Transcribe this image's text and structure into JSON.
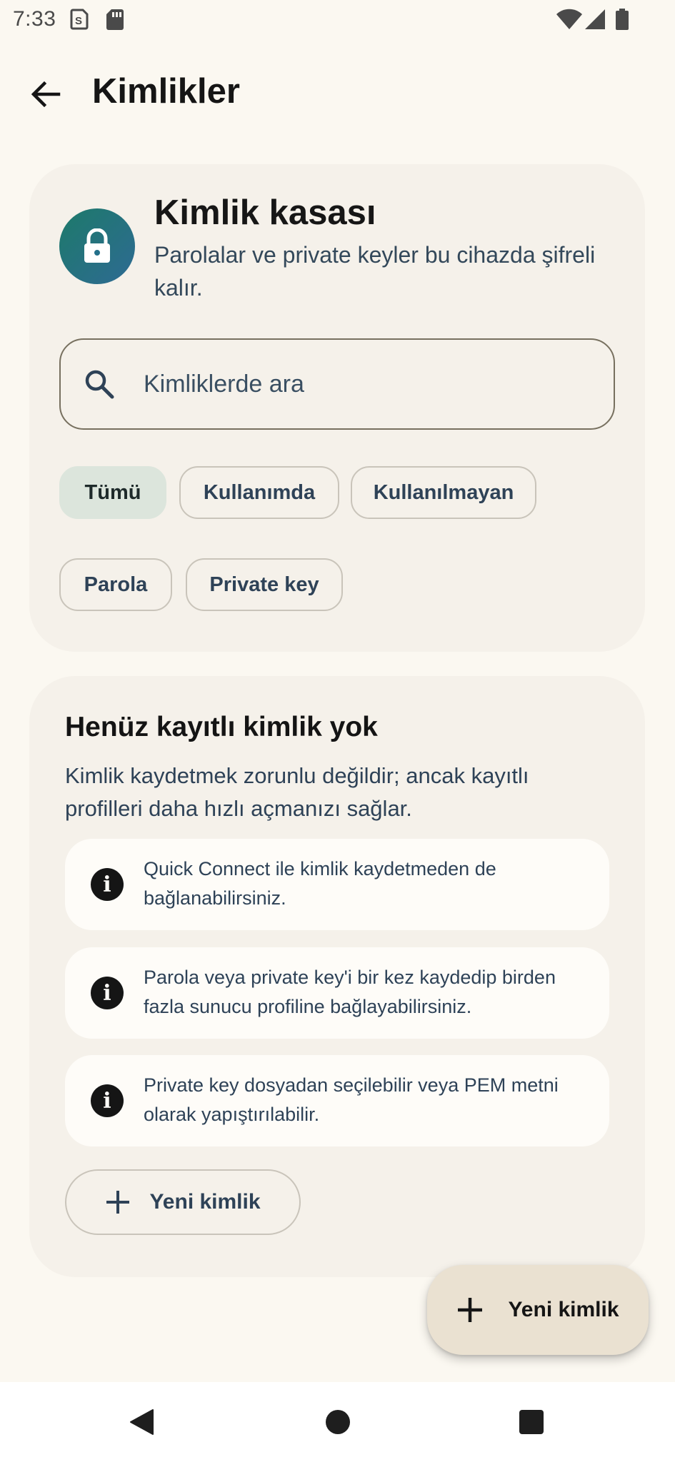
{
  "status_bar": {
    "time": "7:33",
    "icons": [
      "sim-icon",
      "sd-card-icon",
      "wifi-icon",
      "signal-icon",
      "battery-icon"
    ]
  },
  "app_bar": {
    "back_icon": "arrow-back-icon",
    "title": "Kimlikler"
  },
  "vault": {
    "icon": "lock-icon",
    "title": "Kimlik kasası",
    "subtitle": "Parolalar ve private keyler bu cihazda şifreli kalır.",
    "search": {
      "icon": "search-icon",
      "placeholder": "Kimliklerde ara",
      "value": ""
    },
    "filters": [
      {
        "label": "Tümü",
        "selected": true
      },
      {
        "label": "Kullanımda",
        "selected": false
      },
      {
        "label": "Kullanılmayan",
        "selected": false
      },
      {
        "label": "Parola",
        "selected": false
      },
      {
        "label": "Private key",
        "selected": false
      }
    ]
  },
  "empty_state": {
    "title": "Henüz kayıtlı kimlik yok",
    "description": "Kimlik kaydetmek zorunlu değildir; ancak kayıtlı profilleri daha hızlı açmanızı sağlar.",
    "tips": [
      {
        "icon": "info-icon",
        "text": "Quick Connect ile kimlik kaydetmeden de bağlanabilirsiniz."
      },
      {
        "icon": "info-icon",
        "text": "Parola veya private key'i bir kez kaydedip birden fazla sunucu profiline bağlayabilirsiniz."
      },
      {
        "icon": "info-icon",
        "text": "Private key dosyadan seçilebilir veya PEM metni olarak yapıştırılabilir."
      }
    ],
    "new_button_label": "Yeni kimlik"
  },
  "fab": {
    "icon": "plus-icon",
    "label": "Yeni kimlik"
  },
  "nav_bar": {
    "items": [
      "nav-back-icon",
      "nav-home-icon",
      "nav-recents-icon"
    ]
  },
  "colors": {
    "background": "#FBF8F1",
    "card": "#F5F1EA",
    "accent_teal": "#1D7A6A",
    "accent_blue": "#2E6A93",
    "selected_chip": "#DCE5DC",
    "fab": "#EAE1D1"
  }
}
